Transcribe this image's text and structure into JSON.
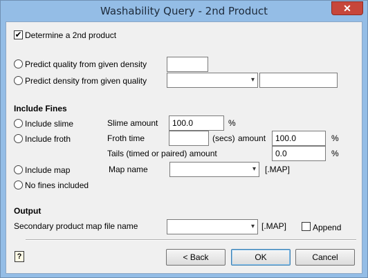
{
  "window": {
    "title": "Washability Query - 2nd Product",
    "close_glyph": "✕"
  },
  "determine": {
    "label": "Determine a 2nd product",
    "checked": true,
    "check_glyph": "✔"
  },
  "predict": {
    "quality_label": "Predict quality from given density",
    "density_label": "Predict density from given quality",
    "quality_value": "",
    "density_select_value": "",
    "density_text_value": ""
  },
  "fines": {
    "heading": "Include Fines",
    "slime_label": "Include slime",
    "froth_label": "Include froth",
    "map_label": "Include map",
    "none_label": "No fines included",
    "slime_amount_label": "Slime amount",
    "slime_amount_value": "100.0",
    "slime_unit": "%",
    "froth_time_label": "Froth time",
    "froth_time_value": "",
    "secs_label": "(secs)",
    "amount_label": "amount",
    "froth_amount_value": "100.0",
    "froth_unit": "%",
    "tails_label": "Tails (timed or paired)  amount",
    "tails_value": "0.0",
    "tails_unit": "%",
    "map_name_label": "Map name",
    "map_name_value": "",
    "map_ext": "[.MAP]"
  },
  "output": {
    "heading": "Output",
    "file_label": "Secondary product map file name",
    "file_value": "",
    "file_ext": "[.MAP]",
    "append_label": "Append",
    "append_checked": false
  },
  "buttons": {
    "back": "< Back",
    "ok": "OK",
    "cancel": "Cancel",
    "help_glyph": "?"
  },
  "icons": {
    "dropdown": "▾"
  }
}
